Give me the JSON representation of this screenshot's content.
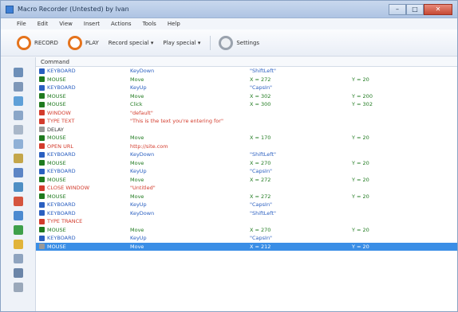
{
  "window": {
    "title": "Macro Recorder (Untested) by Ivan"
  },
  "menu": [
    "File",
    "Edit",
    "View",
    "Insert",
    "Actions",
    "Tools",
    "Help"
  ],
  "toolbar": {
    "record": "RECORD",
    "play": "PLAY",
    "record_special": "Record special ▾",
    "play_special": "Play special ▾",
    "settings": "Settings"
  },
  "grid": {
    "header": "Command"
  },
  "colors": {
    "keyboard": "#2a5fc0",
    "mouse": "#1f7a1f",
    "special": "#d33b2c",
    "selected": "#3a8ee6"
  },
  "rows": [
    {
      "type": "keyboard",
      "c0": "KEYBOARD",
      "c1": "KeyDown",
      "c2": "\"ShiftLeft\"",
      "c3": ""
    },
    {
      "type": "mouse",
      "c0": "MOUSE",
      "c1": "Move",
      "c2": "X = 272",
      "c3": "Y = 20"
    },
    {
      "type": "keyboard",
      "c0": "KEYBOARD",
      "c1": "KeyUp",
      "c2": "\"CapsIn\"",
      "c3": ""
    },
    {
      "type": "mouse",
      "c0": "MOUSE",
      "c1": "Move",
      "c2": "X = 302",
      "c3": "Y = 200"
    },
    {
      "type": "mouse",
      "c0": "MOUSE",
      "c1": "Click",
      "c2": "X = 300",
      "c3": "Y = 302"
    },
    {
      "type": "special",
      "c0": "WINDOW",
      "c1": "\"default\"",
      "c2": "",
      "c3": ""
    },
    {
      "type": "special",
      "c0": "TYPE TEXT",
      "c1": "\"This is the text you're entering for\"",
      "c2": "",
      "c3": ""
    },
    {
      "type": "plain",
      "c0": "DELAY",
      "c1": "",
      "c2": "",
      "c3": ""
    },
    {
      "type": "mouse",
      "c0": "MOUSE",
      "c1": "Move",
      "c2": "X = 170",
      "c3": "Y = 20"
    },
    {
      "type": "special",
      "c0": "OPEN URL",
      "c1": "http://site.com",
      "c2": "",
      "c3": ""
    },
    {
      "type": "keyboard",
      "c0": "KEYBOARD",
      "c1": "KeyDown",
      "c2": "\"ShiftLeft\"",
      "c3": ""
    },
    {
      "type": "mouse",
      "c0": "MOUSE",
      "c1": "Move",
      "c2": "X = 270",
      "c3": "Y = 20"
    },
    {
      "type": "keyboard",
      "c0": "KEYBOARD",
      "c1": "KeyUp",
      "c2": "\"CapsIn\"",
      "c3": ""
    },
    {
      "type": "mouse",
      "c0": "MOUSE",
      "c1": "Move",
      "c2": "X = 272",
      "c3": "Y = 20"
    },
    {
      "type": "special",
      "c0": "CLOSE WINDOW",
      "c1": "\"Untitled\"",
      "c2": "",
      "c3": ""
    },
    {
      "type": "mouse",
      "c0": "MOUSE",
      "c1": "Move",
      "c2": "X = 272",
      "c3": "Y = 20"
    },
    {
      "type": "keyboard",
      "c0": "KEYBOARD",
      "c1": "KeyUp",
      "c2": "\"CapsIn\"",
      "c3": ""
    },
    {
      "type": "keyboard",
      "c0": "KEYBOARD",
      "c1": "KeyDown",
      "c2": "\"ShiftLeft\"",
      "c3": ""
    },
    {
      "type": "special",
      "c0": "TYPE TRANCE",
      "c1": "",
      "c2": "",
      "c3": ""
    },
    {
      "type": "mouse",
      "c0": "MOUSE",
      "c1": "Move",
      "c2": "X = 270",
      "c3": "Y = 20"
    },
    {
      "type": "keyboard",
      "c0": "KEYBOARD",
      "c1": "KeyUp",
      "c2": "\"CapsIn\"",
      "c3": ""
    },
    {
      "type": "selected",
      "c0": "MOUSE",
      "c1": "Move",
      "c2": "X = 212",
      "c3": "Y = 20"
    }
  ]
}
